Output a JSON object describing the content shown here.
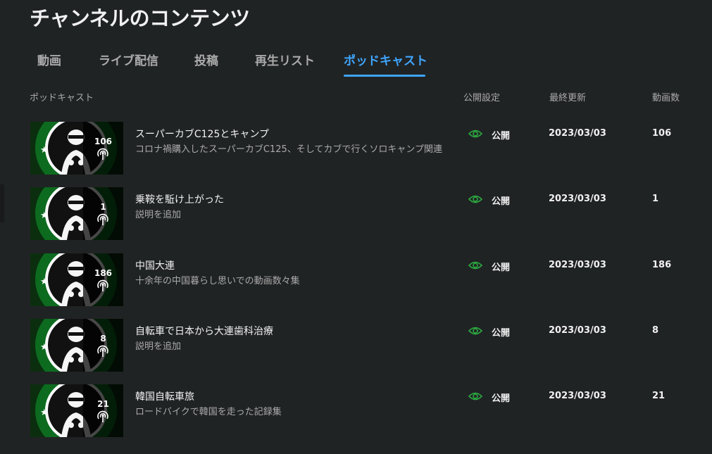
{
  "page": {
    "title": "チャンネルのコンテンツ"
  },
  "tabs": [
    {
      "label": "動画",
      "active": false
    },
    {
      "label": "ライブ配信",
      "active": false
    },
    {
      "label": "投稿",
      "active": false
    },
    {
      "label": "再生リスト",
      "active": false
    },
    {
      "label": "ポッドキャスト",
      "active": true
    }
  ],
  "table": {
    "headers": {
      "podcast": "ポッドキャスト",
      "visibility": "公開設定",
      "last_updated": "最終更新",
      "video_count": "動画数"
    },
    "rows": [
      {
        "title": "スーパーカブC125とキャンプ",
        "description": "コロナ禍購入したスーパーカブC125、そしてカブで行くソロキャンプ関連",
        "thumb_count": "106",
        "visibility": "公開",
        "date": "2023/03/03",
        "count": "106"
      },
      {
        "title": "乗鞍を駈け上がった",
        "description": "説明を追加",
        "thumb_count": "1",
        "visibility": "公開",
        "date": "2023/03/03",
        "count": "1"
      },
      {
        "title": "中国大連",
        "description": "十余年の中国暮らし思いでの動画数々集",
        "thumb_count": "186",
        "visibility": "公開",
        "date": "2023/03/03",
        "count": "186"
      },
      {
        "title": "自転車で日本から大連歯科治療",
        "description": "説明を追加",
        "thumb_count": "8",
        "visibility": "公開",
        "date": "2023/03/03",
        "count": "8"
      },
      {
        "title": "韓国自転車旅",
        "description": "ロードバイクで韓国を走った記録集",
        "thumb_count": "21",
        "visibility": "公開",
        "date": "2023/03/03",
        "count": "21"
      }
    ]
  },
  "icons": {
    "visibility": "eye-icon",
    "podcast": "podcast-icon",
    "thumbnail": "channel-logo"
  },
  "colors": {
    "accent": "#3ea6ff",
    "visibility_icon": "#2ba640",
    "logo_green": "#0d6b1f"
  }
}
